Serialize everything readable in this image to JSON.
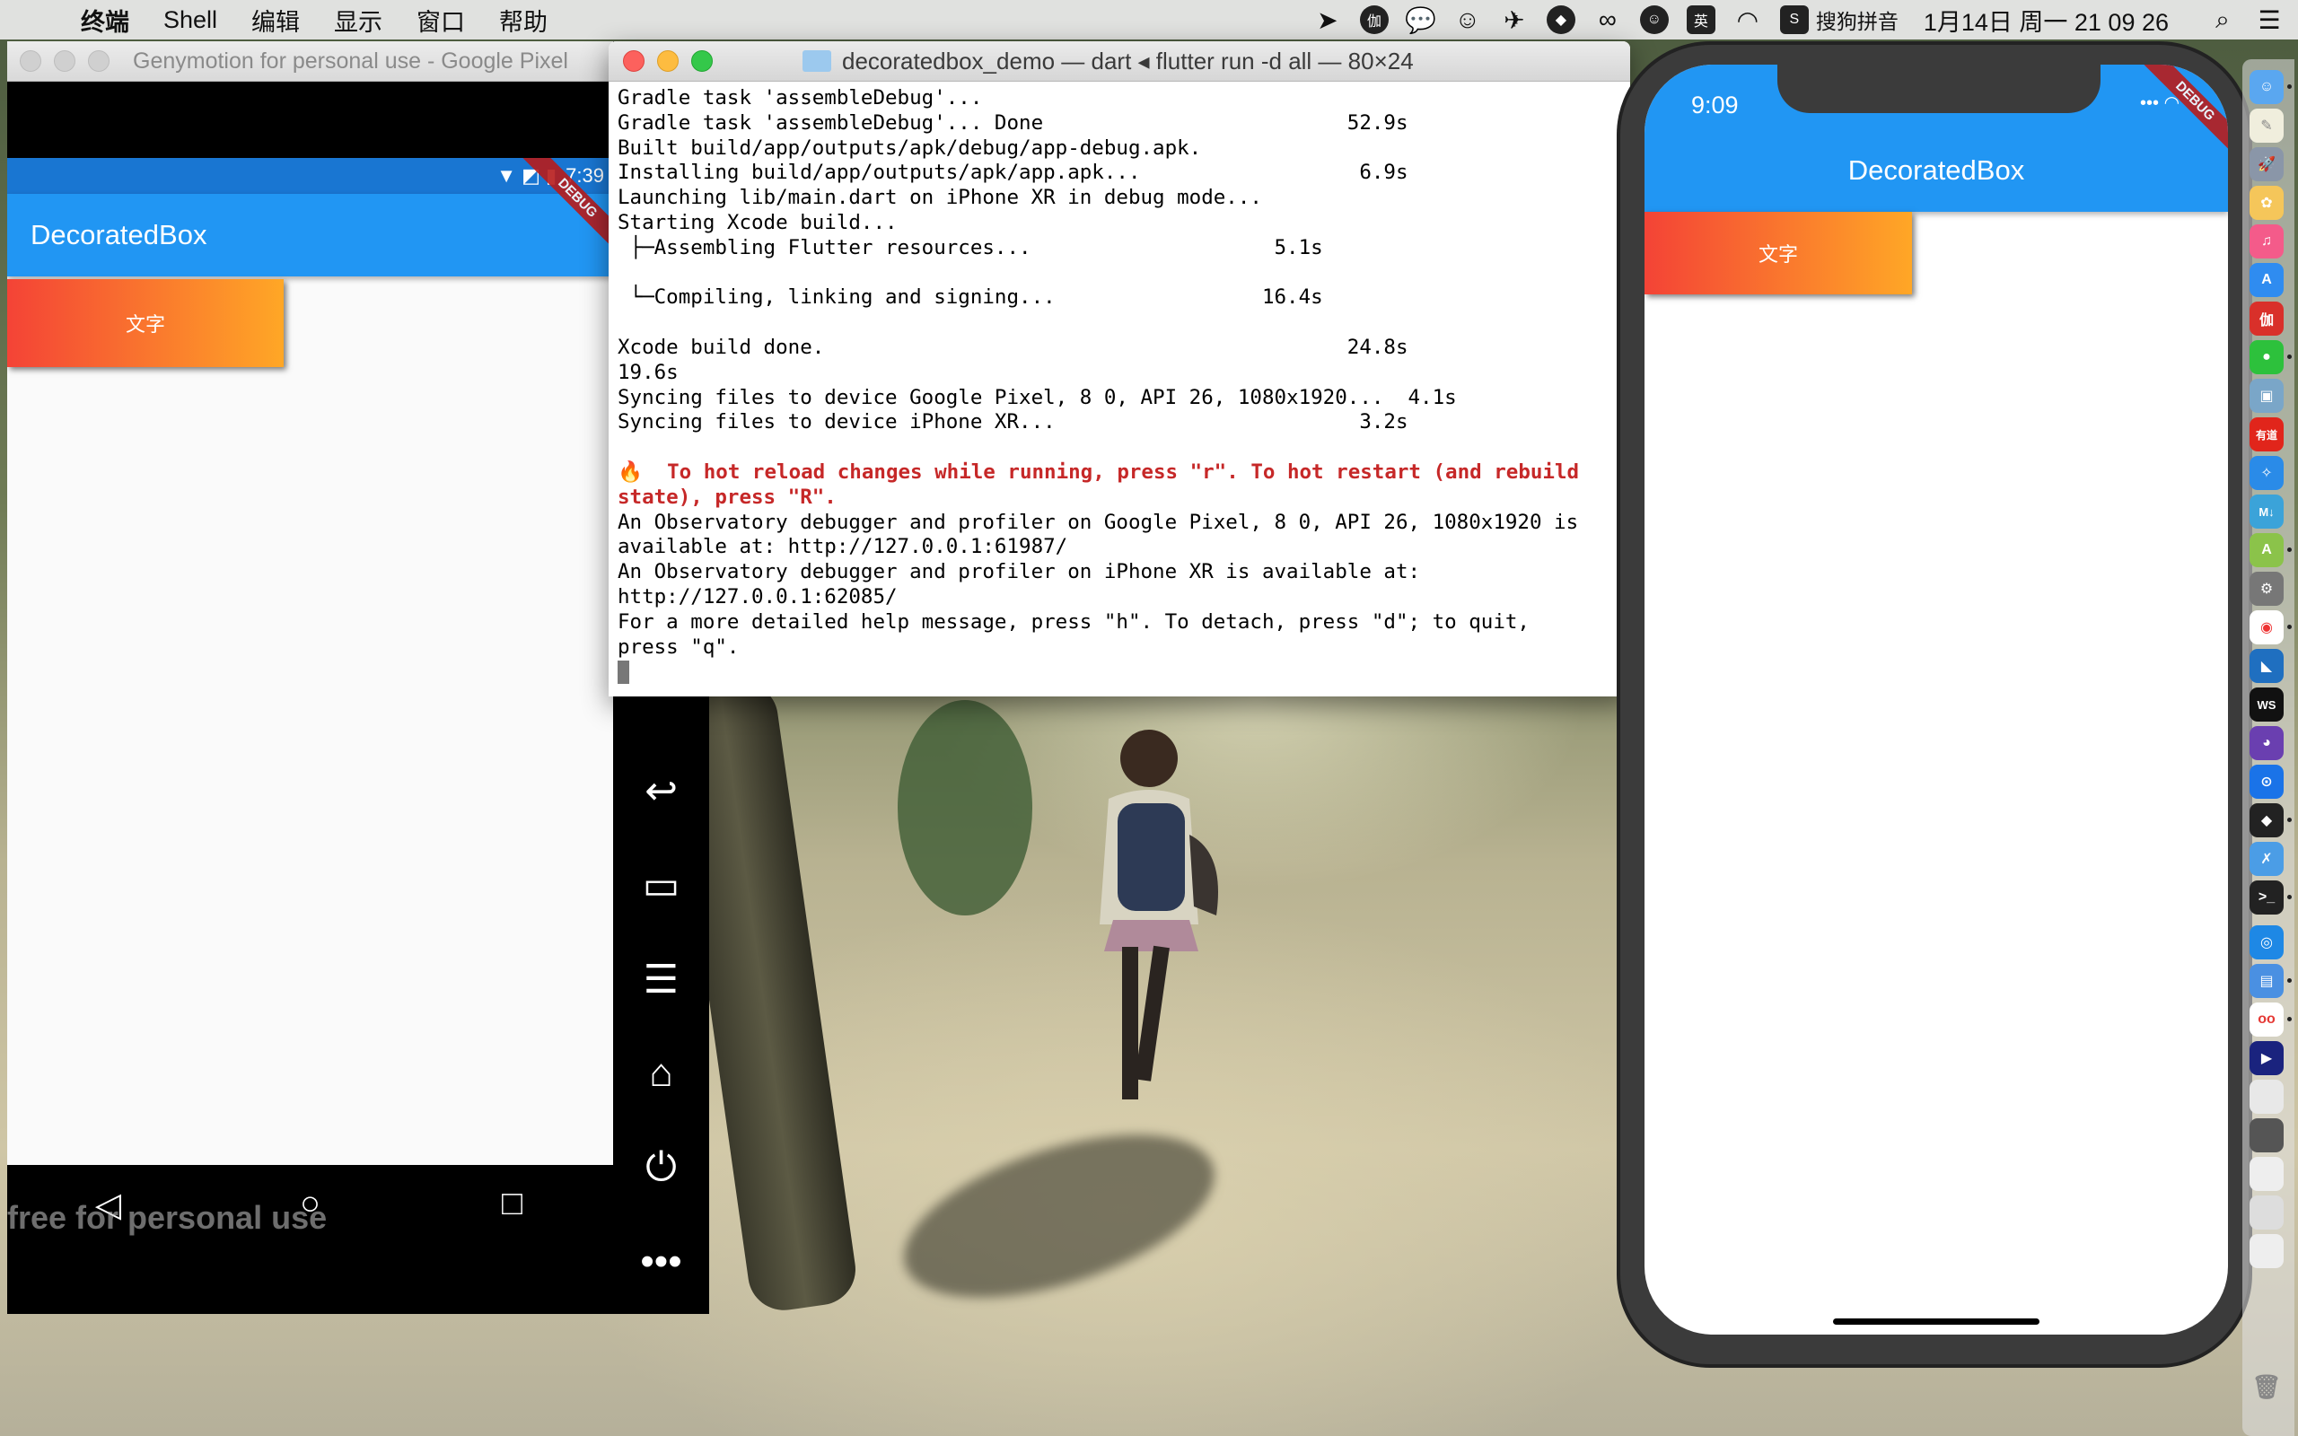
{
  "menubar": {
    "app_name": "终端",
    "menus": [
      "Shell",
      "编辑",
      "显示",
      "窗口",
      "帮助"
    ],
    "ime_label": "搜狗拼音",
    "clock": "1月14日 周一  21 09 26",
    "status_icons": [
      "location-icon",
      "app-icon",
      "wechat-icon",
      "chat-icon",
      "send-icon",
      "qq-icon",
      "creative-cloud-icon",
      "emoji-icon",
      "input-method-icon",
      "wifi-icon",
      "sogou-icon",
      "spotlight-icon",
      "notification-center-icon"
    ],
    "ime_badge": "英",
    "sogou_badge": "S"
  },
  "genymotion": {
    "window_title": "Genymotion for personal use - Google Pixel",
    "status_time": "7:39",
    "app_title": "DecoratedBox",
    "box_text": "文字",
    "debug_label": "DEBUG",
    "watermark": "free for personal use",
    "nav_buttons": [
      "back",
      "home",
      "recents"
    ],
    "side_buttons": [
      "back",
      "recents",
      "menu",
      "home",
      "power",
      "more"
    ]
  },
  "terminal": {
    "window_title": "decoratedbox_demo — dart ◂ flutter run -d all — 80×24",
    "lines": [
      "Gradle task 'assembleDebug'...",
      "Gradle task 'assembleDebug'... Done                         52.9s",
      "Built build/app/outputs/apk/debug/app-debug.apk.",
      "Installing build/app/outputs/apk/app.apk...                  6.9s",
      "Launching lib/main.dart on iPhone XR in debug mode...",
      "Starting Xcode build...",
      " ├─Assembling Flutter resources...                    5.1s",
      "",
      " └─Compiling, linking and signing...                 16.4s",
      "",
      "Xcode build done.                                           24.8s",
      "19.6s",
      "Syncing files to device Google Pixel, 8 0, API 26, 1080x1920...  4.1s",
      "Syncing files to device iPhone XR...                         3.2s",
      ""
    ],
    "hot_reload_line1": "🔥  To hot reload changes while running, press \"r\". To hot restart (and rebuild",
    "hot_reload_line2": "state), press \"R\".",
    "tail_lines": [
      "An Observatory debugger and profiler on Google Pixel, 8 0, API 26, 1080x1920 is",
      "available at: http://127.0.0.1:61987/",
      "An Observatory debugger and profiler on iPhone XR is available at:",
      "http://127.0.0.1:62085/",
      "For a more detailed help message, press \"h\". To detach, press \"d\"; to quit,",
      "press \"q\"."
    ]
  },
  "iphone": {
    "status_time": "9:09",
    "app_title": "DecoratedBox",
    "box_text": "文字",
    "debug_label": "DEBUG"
  },
  "dock": {
    "icons": [
      "finder",
      "notes",
      "launchpad",
      "photos",
      "music",
      "app-store",
      "app-red",
      "wechat",
      "preview",
      "youdao",
      "safari",
      "markdown",
      "android-studio",
      "system-prefs",
      "chrome",
      "vscode",
      "webstorm",
      "github",
      "maps",
      "qq",
      "xcode",
      "terminal",
      "quicktime",
      "simulator",
      "genymotion",
      "player",
      "window-1",
      "window-2",
      "window-3",
      "window-4",
      "window-5",
      "trash"
    ],
    "badges": {
      "app-red": "伽",
      "youdao": "有道",
      "markdown": "M↓",
      "webstorm": "WS"
    }
  }
}
